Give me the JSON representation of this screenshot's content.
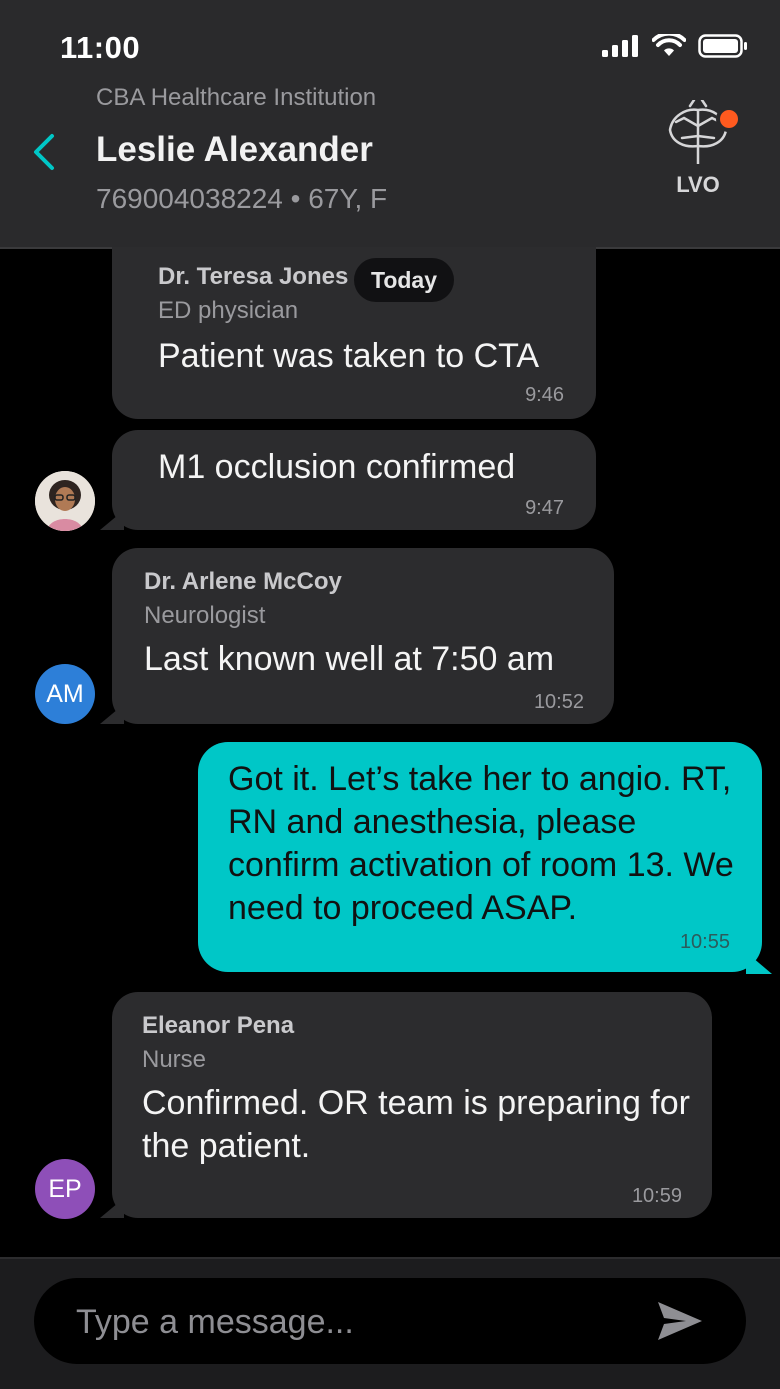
{
  "status_bar": {
    "time": "11:00"
  },
  "header": {
    "institution": "CBA Healthcare Institution",
    "patient_name": "Leslie Alexander",
    "patient_meta": "769004038224 • 67Y, F",
    "badge_label": "LVO",
    "badge_dot_color": "#ff5a1f"
  },
  "day_separator": "Today",
  "messages": [
    {
      "sender": "Dr. Teresa Jones",
      "role": "ED physician",
      "text": "Patient was taken to CTA",
      "time": "9:46"
    },
    {
      "text": "M1 occlusion confirmed",
      "time": "9:47"
    },
    {
      "sender": "Dr. Arlene McCoy",
      "role": "Neurologist",
      "text": "Last known well at 7:50 am",
      "time": "10:52",
      "avatar_initials": "AM",
      "avatar_color": "#2d7fd8"
    },
    {
      "own": true,
      "text": "Got it. Let’s take her to angio. RT, RN and anesthesia, please confirm activation of room 13. We need to proceed ASAP.",
      "time": "10:55"
    },
    {
      "sender": "Eleanor Pena",
      "role": "Nurse",
      "text": "Confirmed. OR team is preparing for the patient.",
      "time": "10:59",
      "avatar_initials": "EP",
      "avatar_color": "#8e4fb8"
    }
  ],
  "composer": {
    "placeholder": "Type a message..."
  },
  "colors": {
    "accent": "#00c7c7",
    "bubble": "#2c2c2e",
    "header": "#2a2a2c"
  }
}
